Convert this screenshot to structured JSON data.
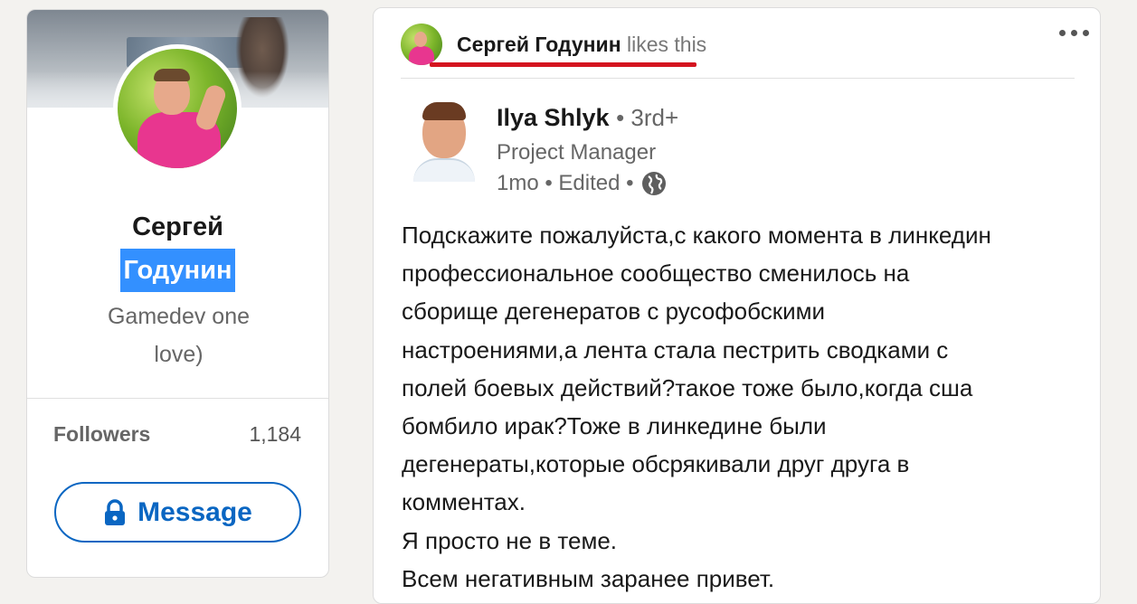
{
  "profile": {
    "first_name": "Сергей",
    "last_name": "Годунин",
    "headline_line1": "Gamedev one",
    "headline_line2": "love)",
    "followers_label": "Followers",
    "followers_count": "1,184",
    "message_label": "Message"
  },
  "post": {
    "activity_actor": "Сергей Годунин",
    "activity_verb": "likes this",
    "author": {
      "name": "Ilya Shlyk",
      "degree": "• 3rd+",
      "title": "Project Manager",
      "meta": "1mo • Edited •"
    },
    "body_lines": [
      "Подскажите пожалуйста,с какого момента в линкедин",
      "профессиональное сообщество сменилось на",
      "сборище дегенератов с русофобскими",
      "настроениями,а лента стала пестрить сводками с",
      "полей боевых действий?такое тоже было,когда сша",
      "бомбило ирак?Тоже в линкедине были",
      "дегенераты,которые обсрякивали друг друга в",
      "комментах.",
      "Я просто не в теме.",
      "Всем негативным заранее привет."
    ]
  },
  "colors": {
    "accent": "#0a66c2",
    "highlight": "#3390ff",
    "underline": "#d4141f"
  },
  "icons": [
    "lock-icon",
    "globe-icon",
    "more-icon"
  ]
}
